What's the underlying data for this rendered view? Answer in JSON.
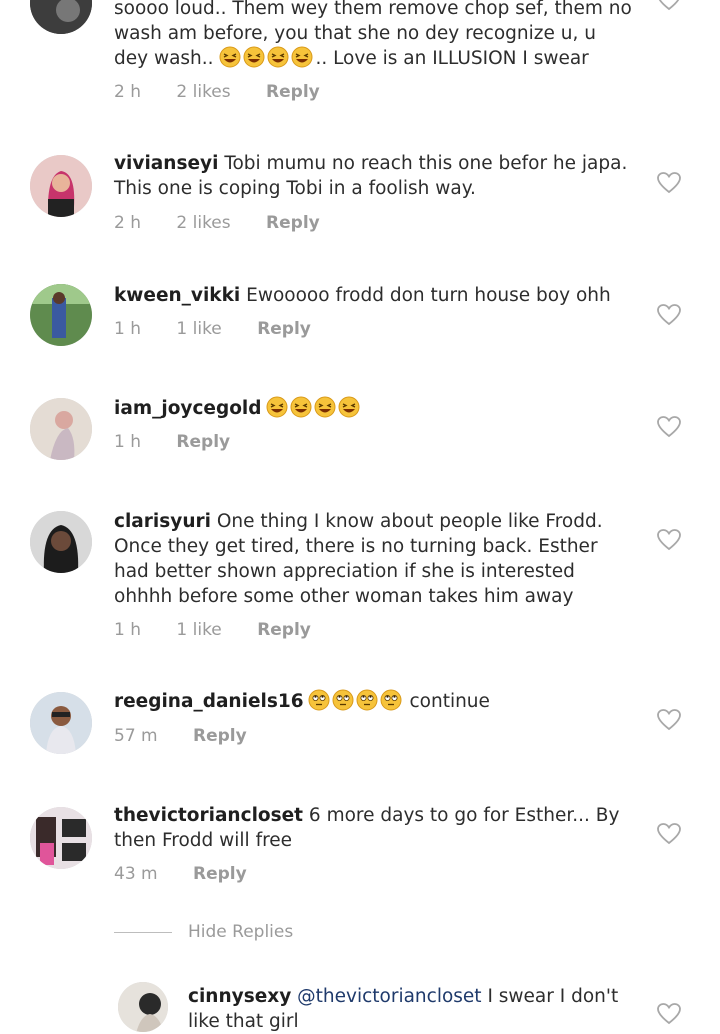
{
  "comments": [
    {
      "username": "",
      "text": "soooo loud.. Them wey them remove chop sef, them no wash am before, you that she no dey recognize u, u dey wash.. 😆😆😆😆.. Love is an ILLUSION I swear",
      "text_before_emoji": "soooo loud.. Them wey them remove chop sef, them no wash am before, you that she no dey recognize u, u dey wash.. ",
      "text_after_emoji": ".. Love is an ILLUSION I swear",
      "time": "2 h",
      "likes": "2 likes",
      "reply": "Reply"
    },
    {
      "username": "vivianseyi",
      "text": "Tobi mumu no reach this one befor he japa. This one is coping Tobi in a foolish way.",
      "time": "2 h",
      "likes": "2 likes",
      "reply": "Reply"
    },
    {
      "username": "kween_vikki",
      "text": "Ewooooo frodd don turn house boy ohh",
      "time": "1 h",
      "likes": "1 like",
      "reply": "Reply"
    },
    {
      "username": "iam_joycegold",
      "text": "😆😆😆😆",
      "time": "1 h",
      "likes": "",
      "reply": "Reply"
    },
    {
      "username": "clarisyuri",
      "text": "One thing I know about people like Frodd. Once they get tired, there is no turning back. Esther had better shown appreciation if she is interested ohhhh before some other woman takes him away",
      "time": "1 h",
      "likes": "1 like",
      "reply": "Reply"
    },
    {
      "username": "reegina_daniels16",
      "text": "🙄🙄🙄🙄 continue",
      "text_after_emoji": " continue",
      "time": "57 m",
      "likes": "",
      "reply": "Reply"
    },
    {
      "username": "thevictoriancloset",
      "text": "6 more days to go for Esther... By then Frodd will free",
      "time": "43 m",
      "likes": "",
      "reply": "Reply"
    }
  ],
  "hide_replies": "Hide Replies",
  "reply_comment": {
    "username": "cinnysexy",
    "mention": "@thevictoriancloset",
    "text": " I swear I don't like that girl"
  },
  "colors": {
    "text": "#262626",
    "meta": "#9a9a9a",
    "mention": "#1f3a6b",
    "emoji_face": "#f6c33a"
  },
  "icons": {
    "like": "heart-outline-icon",
    "laugh_emoji": "grinning-squinting-face",
    "eyeroll_emoji": "face-with-rolling-eyes"
  }
}
